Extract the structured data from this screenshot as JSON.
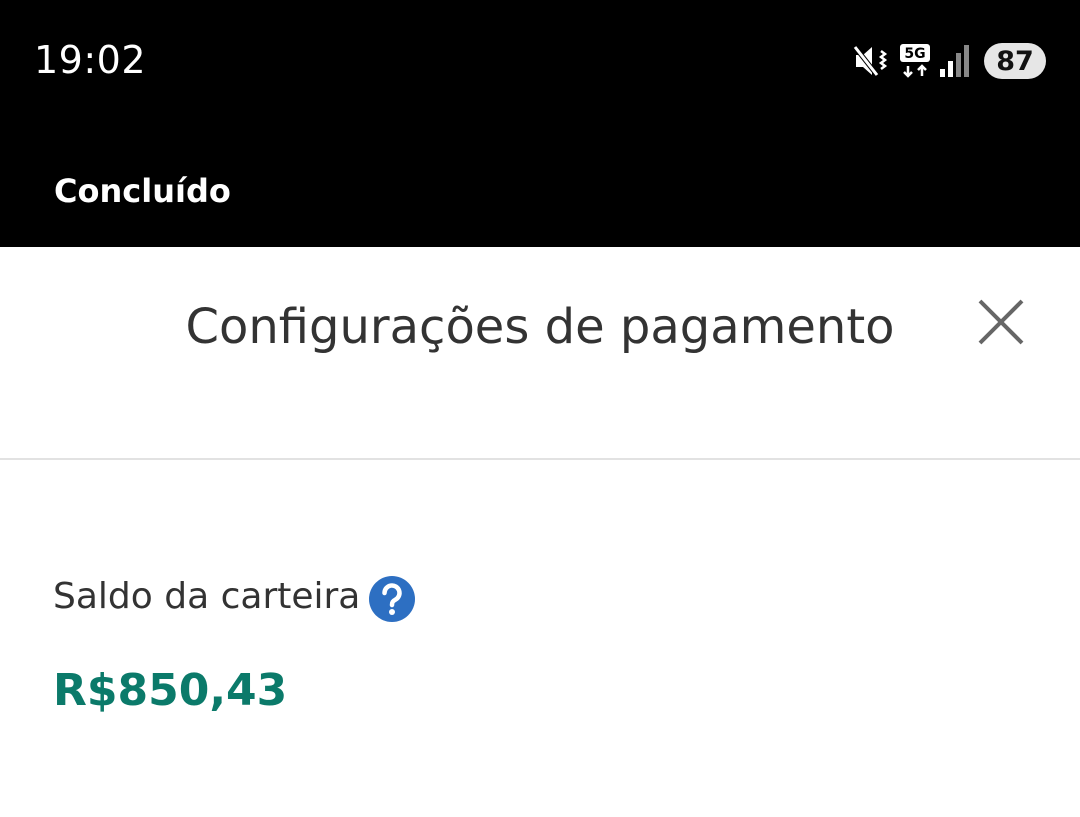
{
  "status_bar": {
    "time": "19:02",
    "network_label": "5G",
    "battery": "87",
    "icons": [
      "mute-vibrate-icon",
      "5g-data-icon",
      "signal-icon"
    ]
  },
  "toolbar": {
    "done_label": "Concluído"
  },
  "header": {
    "title": "Configurações de pagamento",
    "close_icon": "close-icon"
  },
  "wallet": {
    "label": "Saldo da carteira",
    "help_icon": "help-icon",
    "balance": "R$850,43"
  },
  "colors": {
    "topbar": "#000000",
    "balance": "#0b7a6a",
    "help_icon": "#2d6fc2",
    "title_text": "#333333"
  }
}
